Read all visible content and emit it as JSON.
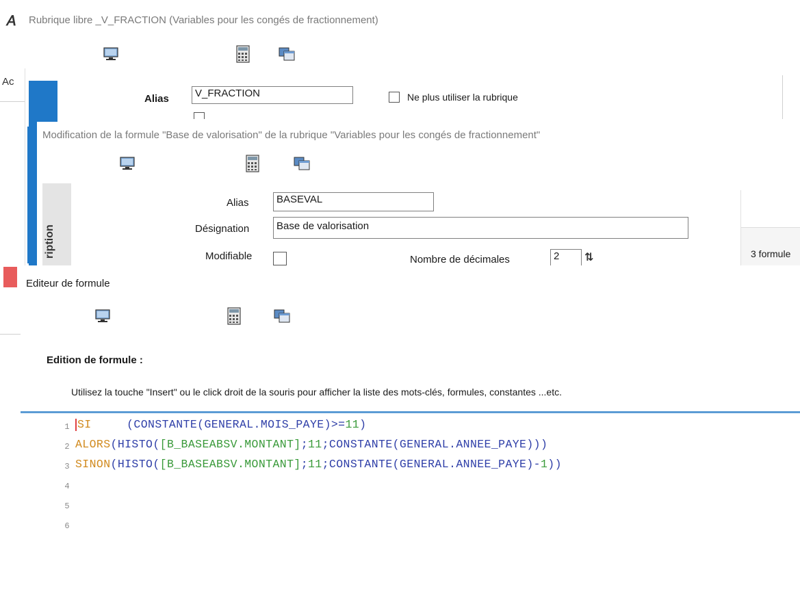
{
  "colors": {
    "accent_blue": "#1f78c8",
    "accent_red": "#e85c5c",
    "keyword": "#d18a1e",
    "function": "#2f3fa8",
    "reference": "#3a9a3a"
  },
  "icons": [
    "monitor-icon",
    "calculator-icon",
    "windows-icon"
  ],
  "window1": {
    "title": "Rubrique libre _V_FRACTION (Variables pour les congés de fractionnement)",
    "side_text": "Ac",
    "alias_label": "Alias",
    "alias_value": "V_FRACTION",
    "deprecated_label": "Ne plus utiliser la rubrique"
  },
  "window2": {
    "title": "Modification de la formule \"Base de valorisation\" de la rubrique \"Variables pour les congés de fractionnement\"",
    "tab_label": "ription",
    "alias_label": "Alias",
    "alias_value": "BASEVAL",
    "designation_label": "Désignation",
    "designation_value": "Base de valorisation",
    "modifiable_label": "Modifiable",
    "decimals_label": "Nombre de décimales",
    "decimals_value": "2",
    "right_text": "3 formule"
  },
  "window3": {
    "title": "Editeur de formule",
    "section_title": "Edition de formule :",
    "hint": "Utilisez la touche \"Insert\" ou le click droit de la souris pour afficher la liste des mots-clés, formules, constantes ...etc.",
    "lines": [
      {
        "num": "1",
        "tokens": [
          {
            "t": "SI",
            "c": "kw"
          },
          {
            "t": "     ",
            "c": "plain"
          },
          {
            "t": "(CONSTANTE(GENERAL.MOIS_PAYE)>=",
            "c": "fn"
          },
          {
            "t": "11",
            "c": "num"
          },
          {
            "t": ")",
            "c": "fn"
          }
        ]
      },
      {
        "num": "2",
        "tokens": [
          {
            "t": "ALORS",
            "c": "kw"
          },
          {
            "t": "(HISTO(",
            "c": "fn"
          },
          {
            "t": "[B_BASEABSV.MONTANT]",
            "c": "ref"
          },
          {
            "t": ";",
            "c": "fn"
          },
          {
            "t": "11",
            "c": "num"
          },
          {
            "t": ";CONSTANTE(GENERAL.ANNEE_PAYE)))",
            "c": "fn"
          }
        ]
      },
      {
        "num": "3",
        "tokens": [
          {
            "t": "SINON",
            "c": "kw"
          },
          {
            "t": "(HISTO(",
            "c": "fn"
          },
          {
            "t": "[B_BASEABSV.MONTANT]",
            "c": "ref"
          },
          {
            "t": ";",
            "c": "fn"
          },
          {
            "t": "11",
            "c": "num"
          },
          {
            "t": ";CONSTANTE(GENERAL.ANNEE_PAYE)-",
            "c": "fn"
          },
          {
            "t": "1",
            "c": "num"
          },
          {
            "t": "))",
            "c": "fn"
          }
        ]
      },
      {
        "num": "4",
        "tokens": []
      },
      {
        "num": "5",
        "tokens": []
      },
      {
        "num": "6",
        "tokens": []
      }
    ]
  }
}
